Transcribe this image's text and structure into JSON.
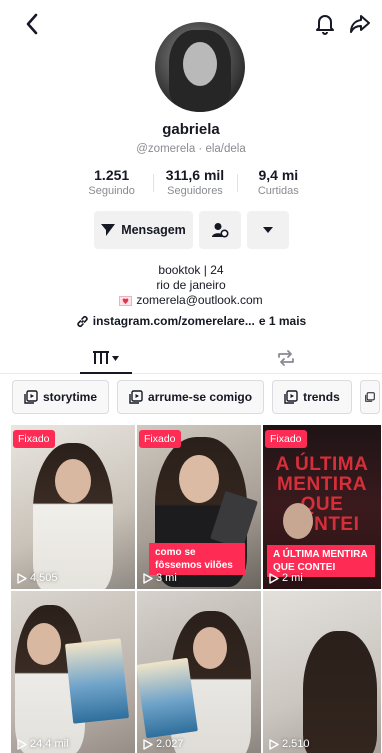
{
  "profile": {
    "name": "gabriela",
    "handle": "@zomerela · ela/dela",
    "stats": [
      {
        "value": "1.251",
        "label": "Seguindo"
      },
      {
        "value": "311,6 mil",
        "label": "Seguidores"
      },
      {
        "value": "9,4 mi",
        "label": "Curtidas"
      }
    ]
  },
  "actions": {
    "message_label": "Mensagem"
  },
  "bio": {
    "line1": "booktok | 24",
    "line2": "rio de janeiro",
    "email": "zomerela@outlook.com",
    "link": "instagram.com/zomerelare...",
    "more": "e 1 mais"
  },
  "chips": [
    "storytime",
    "arrume-se comigo",
    "trends"
  ],
  "videos": [
    {
      "pinned": "Fixado",
      "views": "4.505",
      "caption": ""
    },
    {
      "pinned": "Fixado",
      "views": "3 mi",
      "caption": "como se fôssemos vilões"
    },
    {
      "pinned": "Fixado",
      "views": "2 mi",
      "caption": "A ÚLTIMA MENTIRA QUE CONTEI",
      "title": "A ÚLTIMA MENTIRA QUE CONTEI"
    },
    {
      "pinned": "",
      "views": "24,4 mil",
      "caption": ""
    },
    {
      "pinned": "",
      "views": "2.027",
      "caption": ""
    },
    {
      "pinned": "",
      "views": "2.510",
      "caption": ""
    }
  ],
  "colors": {
    "accent": "#fe2c55",
    "text": "#161823",
    "muted": "#8a8b91"
  },
  "icons": [
    "back-arrow-icon",
    "bell-icon",
    "share-icon",
    "send-icon",
    "add-friend-icon",
    "dropdown-icon",
    "heart-mail-icon",
    "link-icon",
    "grid-icon",
    "repost-icon",
    "playlist-icon",
    "play-icon"
  ]
}
